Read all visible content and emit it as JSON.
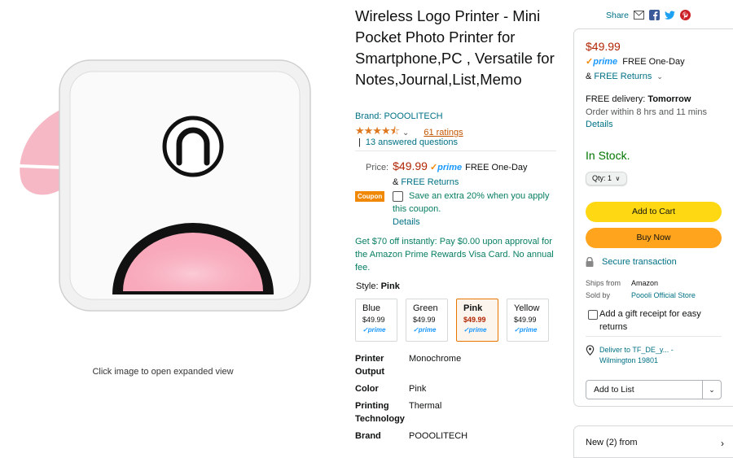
{
  "image": {
    "hint": "Click image to open expanded view"
  },
  "product": {
    "title": "Wireless Logo Printer - Mini Pocket Photo Printer for Smartphone,PC , Versatile for Notes,Journal,List,Memo",
    "brand": "Brand: POOOLITECH",
    "stars": "★★★★⯪",
    "stars_chevron": "⌄",
    "ratings": "61 ratings",
    "answered": "13 answered questions",
    "answered_sep": "|"
  },
  "price_block": {
    "label": "Price:",
    "price": "$49.99",
    "prime_check": "✓",
    "prime": "prime",
    "one_day": "FREE One-Day",
    "and": "&",
    "free_returns": "FREE Returns",
    "coupon_badge": "Coupon",
    "coupon_text": "Save an extra 20% when you apply this coupon.",
    "coupon_details": "Details",
    "visa_offer": "Get $70 off instantly: Pay $0.00 upon approval for the Amazon Prime Rewards Visa Card. No annual fee."
  },
  "style": {
    "label": "Style:",
    "selected": "Pink",
    "options": [
      {
        "name": "Blue",
        "price": "$49.99",
        "prime": "✓prime"
      },
      {
        "name": "Green",
        "price": "$49.99",
        "prime": "✓prime"
      },
      {
        "name": "Pink",
        "price": "$49.99",
        "prime": "✓prime"
      },
      {
        "name": "Yellow",
        "price": "$49.99",
        "prime": "✓prime"
      }
    ]
  },
  "specs": [
    {
      "key": "Printer Output",
      "value": "Monochrome"
    },
    {
      "key": "Color",
      "value": "Pink"
    },
    {
      "key": "Printing Technology",
      "value": "Thermal"
    },
    {
      "key": "Brand",
      "value": "POOOLITECH"
    }
  ],
  "share": {
    "label": "Share"
  },
  "buybox": {
    "price": "$49.99",
    "prime_check": "✓",
    "prime": "prime",
    "one_day": "FREE One-Day",
    "and": "&",
    "free_returns": "FREE Returns",
    "returns_chevron": "⌄",
    "delivery_prefix": "FREE delivery:",
    "delivery_day": "Tomorrow",
    "order_within": "Order within 8 hrs and 11 mins",
    "details": "Details",
    "stock": "In Stock.",
    "qty": "Qty: 1",
    "add_to_cart": "Add to Cart",
    "buy_now": "Buy Now",
    "secure": "Secure transaction",
    "ships_from_label": "Ships from",
    "ships_from": "Amazon",
    "sold_by_label": "Sold by",
    "sold_by": "Poooli Official Store",
    "gift": "Add a gift receipt for easy returns",
    "deliver_to": "Deliver to TF_DE_y... - Wilmington 19801",
    "add_to_list": "Add to List",
    "dropdown": "⌄"
  },
  "new_from": {
    "label": "New (2) from",
    "chevron": "›"
  },
  "colors": {
    "link": "#007185",
    "price": "#b12704",
    "prime": "#1a98ff",
    "add_to_cart": "#ffd814",
    "buy_now": "#ffa41c",
    "in_stock": "#007600",
    "star": "#de7921"
  }
}
